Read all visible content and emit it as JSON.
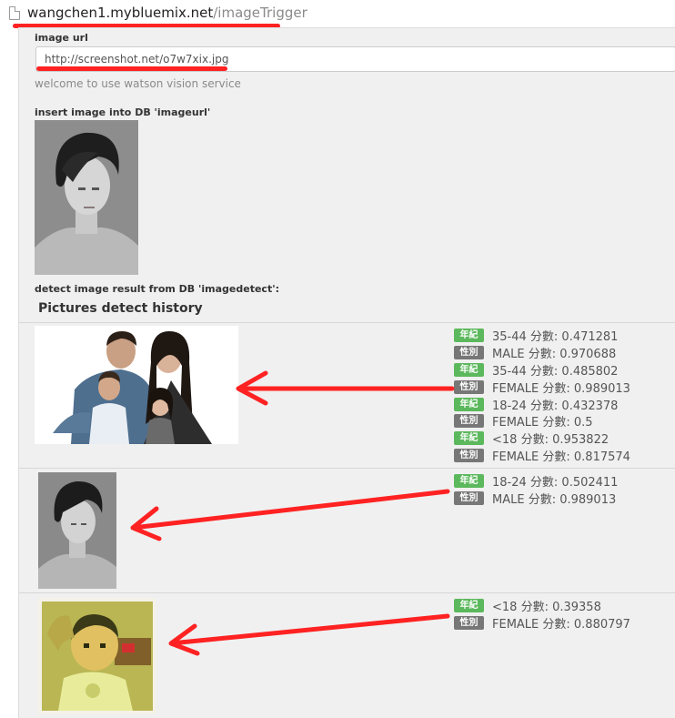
{
  "browser": {
    "url_host": "wangchen1.mybluemix.net",
    "url_path": "/imageTrigger"
  },
  "form": {
    "image_url_label": "image url",
    "image_url_value": "http://screenshot.net/o7w7xix.jpg",
    "welcome_text": "welcome to use watson vision service",
    "insert_label": "insert image into DB 'imageurl'",
    "detect_label": "detect image result from DB 'imagedetect':"
  },
  "history": {
    "title": "Pictures detect history",
    "entries": [
      {
        "tags": [
          {
            "badge": "年紀",
            "kind": "age",
            "text": "35-44 分數: 0.471281"
          },
          {
            "badge": "性別",
            "kind": "gender",
            "text": "MALE 分數: 0.970688"
          },
          {
            "badge": "年紀",
            "kind": "age",
            "text": "35-44 分數: 0.485802"
          },
          {
            "badge": "性別",
            "kind": "gender",
            "text": "FEMALE 分數: 0.989013"
          },
          {
            "badge": "年紀",
            "kind": "age",
            "text": "18-24 分數: 0.432378"
          },
          {
            "badge": "性別",
            "kind": "gender",
            "text": "FEMALE 分數: 0.5"
          },
          {
            "badge": "年紀",
            "kind": "age",
            "text": "<18 分數: 0.953822"
          },
          {
            "badge": "性別",
            "kind": "gender",
            "text": "FEMALE 分數: 0.817574"
          }
        ]
      },
      {
        "tags": [
          {
            "badge": "年紀",
            "kind": "age",
            "text": "18-24 分數: 0.502411"
          },
          {
            "badge": "性別",
            "kind": "gender",
            "text": "MALE 分數: 0.989013"
          }
        ]
      },
      {
        "tags": [
          {
            "badge": "年紀",
            "kind": "age",
            "text": "<18 分數: 0.39358"
          },
          {
            "badge": "性別",
            "kind": "gender",
            "text": "FEMALE 分數: 0.880797"
          }
        ]
      }
    ]
  },
  "colors": {
    "age_badge": "#5cb85c",
    "gender_badge": "#777777",
    "annotation_red": "#ff2222"
  }
}
